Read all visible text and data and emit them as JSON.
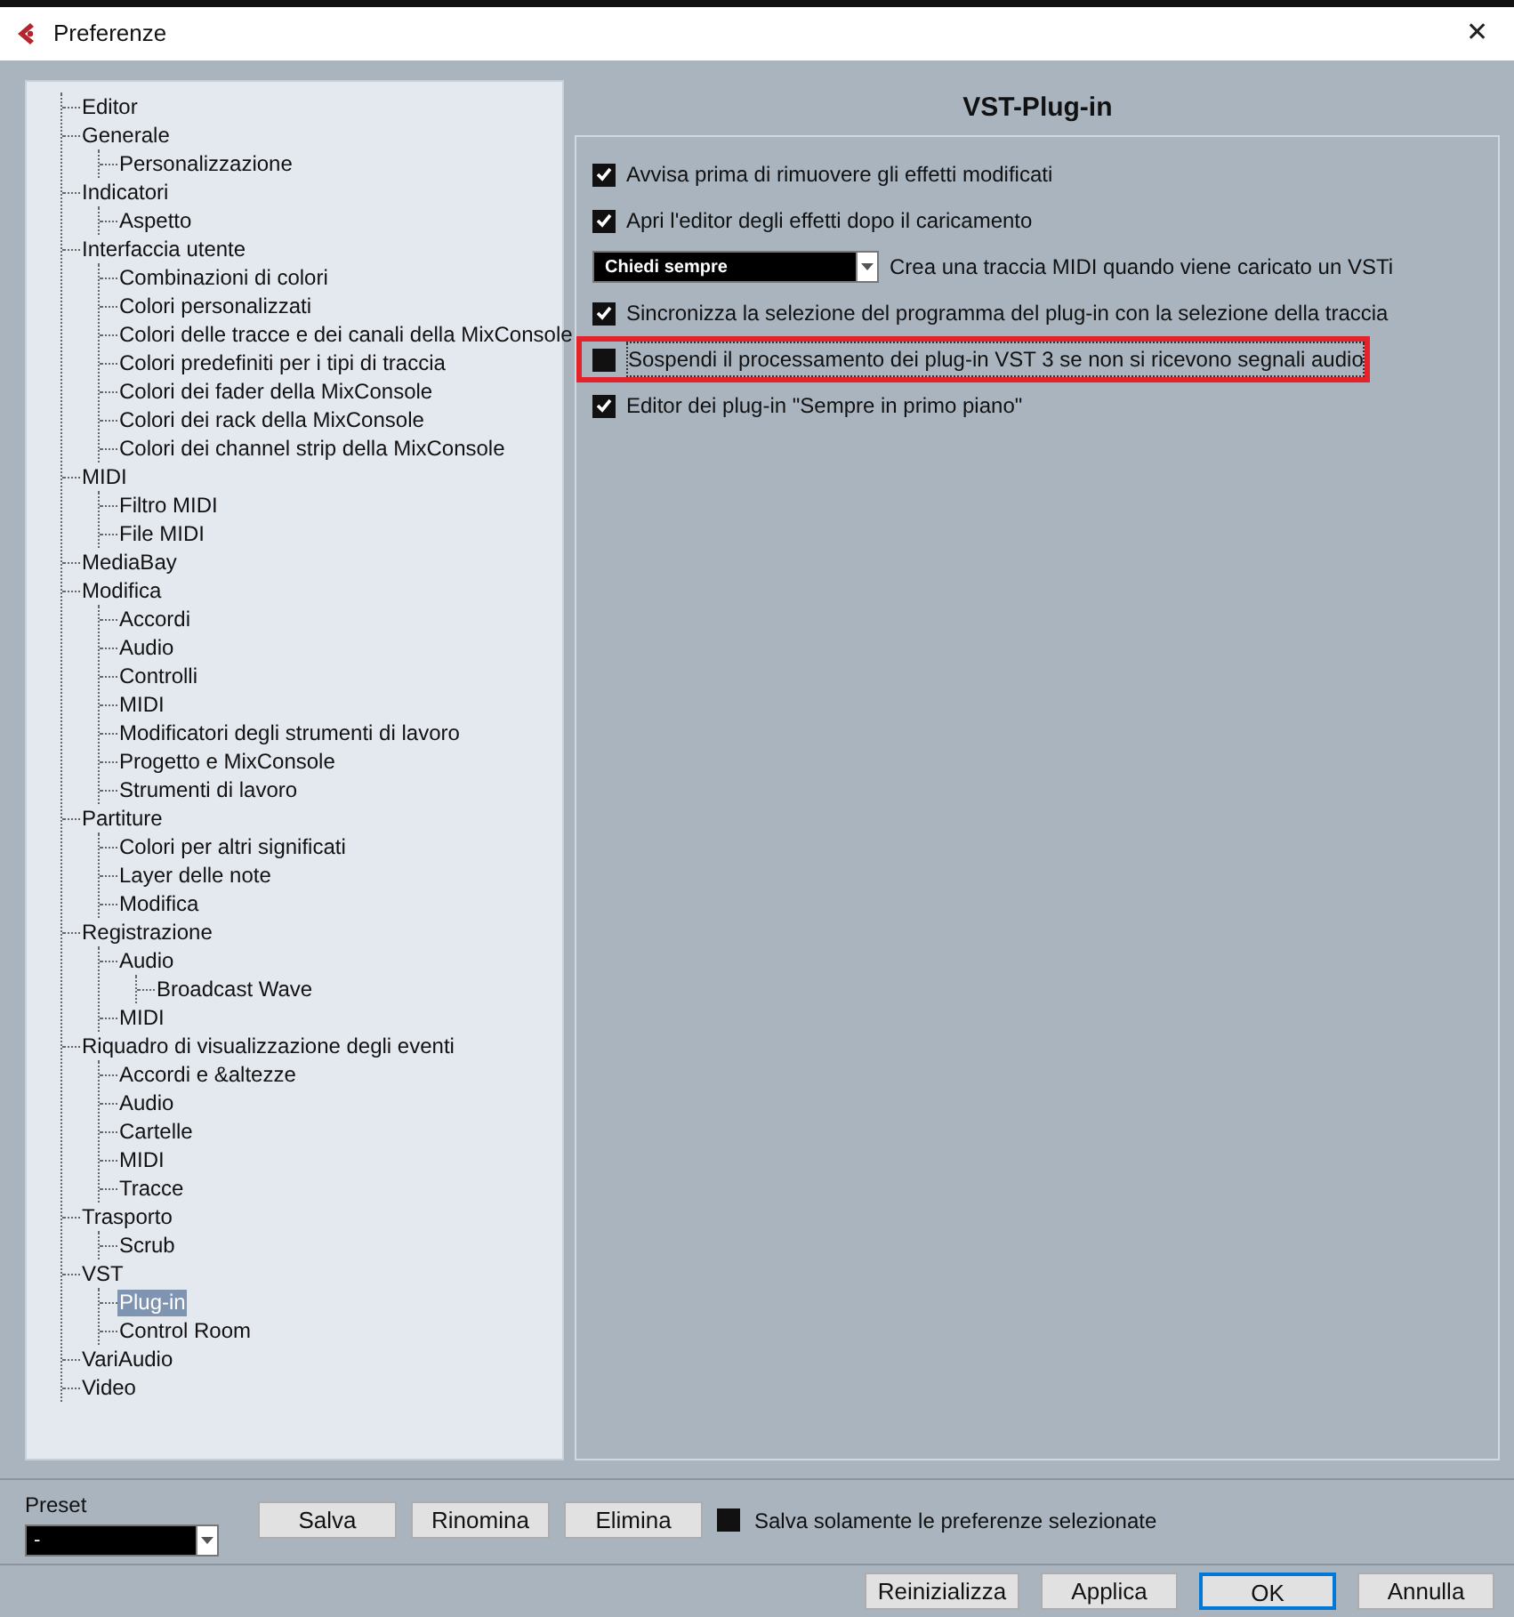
{
  "window": {
    "title": "Preferenze",
    "close": "✕"
  },
  "tree": [
    {
      "label": "Editor",
      "selected": false
    },
    {
      "label": "Generale",
      "selected": false,
      "children": [
        {
          "label": "Personalizzazione",
          "selected": false
        }
      ]
    },
    {
      "label": "Indicatori",
      "selected": false,
      "children": [
        {
          "label": "Aspetto",
          "selected": false
        }
      ]
    },
    {
      "label": "Interfaccia utente",
      "selected": false,
      "children": [
        {
          "label": "Combinazioni di colori",
          "selected": false
        },
        {
          "label": "Colori personalizzati",
          "selected": false
        },
        {
          "label": "Colori delle tracce e dei canali della MixConsole",
          "selected": false
        },
        {
          "label": "Colori predefiniti per i tipi di traccia",
          "selected": false
        },
        {
          "label": "Colori dei fader della MixConsole",
          "selected": false
        },
        {
          "label": "Colori dei rack della MixConsole",
          "selected": false
        },
        {
          "label": "Colori dei channel strip della MixConsole",
          "selected": false
        }
      ]
    },
    {
      "label": "MIDI",
      "selected": false,
      "children": [
        {
          "label": "Filtro MIDI",
          "selected": false
        },
        {
          "label": "File MIDI",
          "selected": false
        }
      ]
    },
    {
      "label": "MediaBay",
      "selected": false
    },
    {
      "label": "Modifica",
      "selected": false,
      "children": [
        {
          "label": "Accordi",
          "selected": false
        },
        {
          "label": "Audio",
          "selected": false
        },
        {
          "label": "Controlli",
          "selected": false
        },
        {
          "label": "MIDI",
          "selected": false
        },
        {
          "label": "Modificatori degli strumenti di lavoro",
          "selected": false
        },
        {
          "label": "Progetto e MixConsole",
          "selected": false
        },
        {
          "label": "Strumenti di lavoro",
          "selected": false
        }
      ]
    },
    {
      "label": "Partiture",
      "selected": false,
      "children": [
        {
          "label": "Colori per altri significati",
          "selected": false
        },
        {
          "label": "Layer delle note",
          "selected": false
        },
        {
          "label": "Modifica",
          "selected": false
        }
      ]
    },
    {
      "label": "Registrazione",
      "selected": false,
      "children": [
        {
          "label": "Audio",
          "selected": false,
          "children": [
            {
              "label": "Broadcast Wave",
              "selected": false
            }
          ]
        },
        {
          "label": "MIDI",
          "selected": false
        }
      ]
    },
    {
      "label": "Riquadro di visualizzazione degli eventi",
      "selected": false,
      "children": [
        {
          "label": "Accordi e &altezze",
          "selected": false
        },
        {
          "label": "Audio",
          "selected": false
        },
        {
          "label": "Cartelle",
          "selected": false
        },
        {
          "label": "MIDI",
          "selected": false
        },
        {
          "label": "Tracce",
          "selected": false
        }
      ]
    },
    {
      "label": "Trasporto",
      "selected": false,
      "children": [
        {
          "label": "Scrub",
          "selected": false
        }
      ]
    },
    {
      "label": "VST",
      "selected": false,
      "children": [
        {
          "label": "Plug-in",
          "selected": true
        },
        {
          "label": "Control Room",
          "selected": false
        }
      ]
    },
    {
      "label": "VariAudio",
      "selected": false
    },
    {
      "label": "Video",
      "selected": false
    }
  ],
  "panel": {
    "title": "VST-Plug-in",
    "options": [
      {
        "kind": "checkbox",
        "label": "Avvisa prima di rimuovere gli effetti modificati",
        "checked": true,
        "highlighted": false
      },
      {
        "kind": "checkbox",
        "label": "Apri l'editor degli effetti dopo il caricamento",
        "checked": true,
        "highlighted": false
      },
      {
        "kind": "dropdown",
        "dropdown": {
          "value": "Chiedi sempre"
        },
        "label": "Crea una traccia MIDI quando viene caricato un VSTi",
        "highlighted": false
      },
      {
        "kind": "checkbox",
        "label": "Sincronizza la selezione del programma del plug-in con la selezione della traccia",
        "checked": true,
        "highlighted": false
      },
      {
        "kind": "checkbox",
        "label": "Sospendi il processamento dei plug-in VST 3 se non si ricevono segnali audio",
        "checked": false,
        "highlighted": true
      },
      {
        "kind": "checkbox",
        "label": "Editor dei plug-in \"Sempre in primo piano\"",
        "checked": true,
        "highlighted": false
      }
    ]
  },
  "preset": {
    "label": "Preset",
    "value": "-",
    "buttons": [
      "Salva",
      "Rinomina",
      "Elimina"
    ],
    "only_selected": {
      "label": "Salva solamente le preferenze selezionate",
      "checked": false
    }
  },
  "footer_buttons": [
    {
      "label": "Reinizializza",
      "default": false
    },
    {
      "label": "Applica",
      "default": false
    },
    {
      "label": "OK",
      "default": true
    },
    {
      "label": "Annulla",
      "default": false
    }
  ]
}
